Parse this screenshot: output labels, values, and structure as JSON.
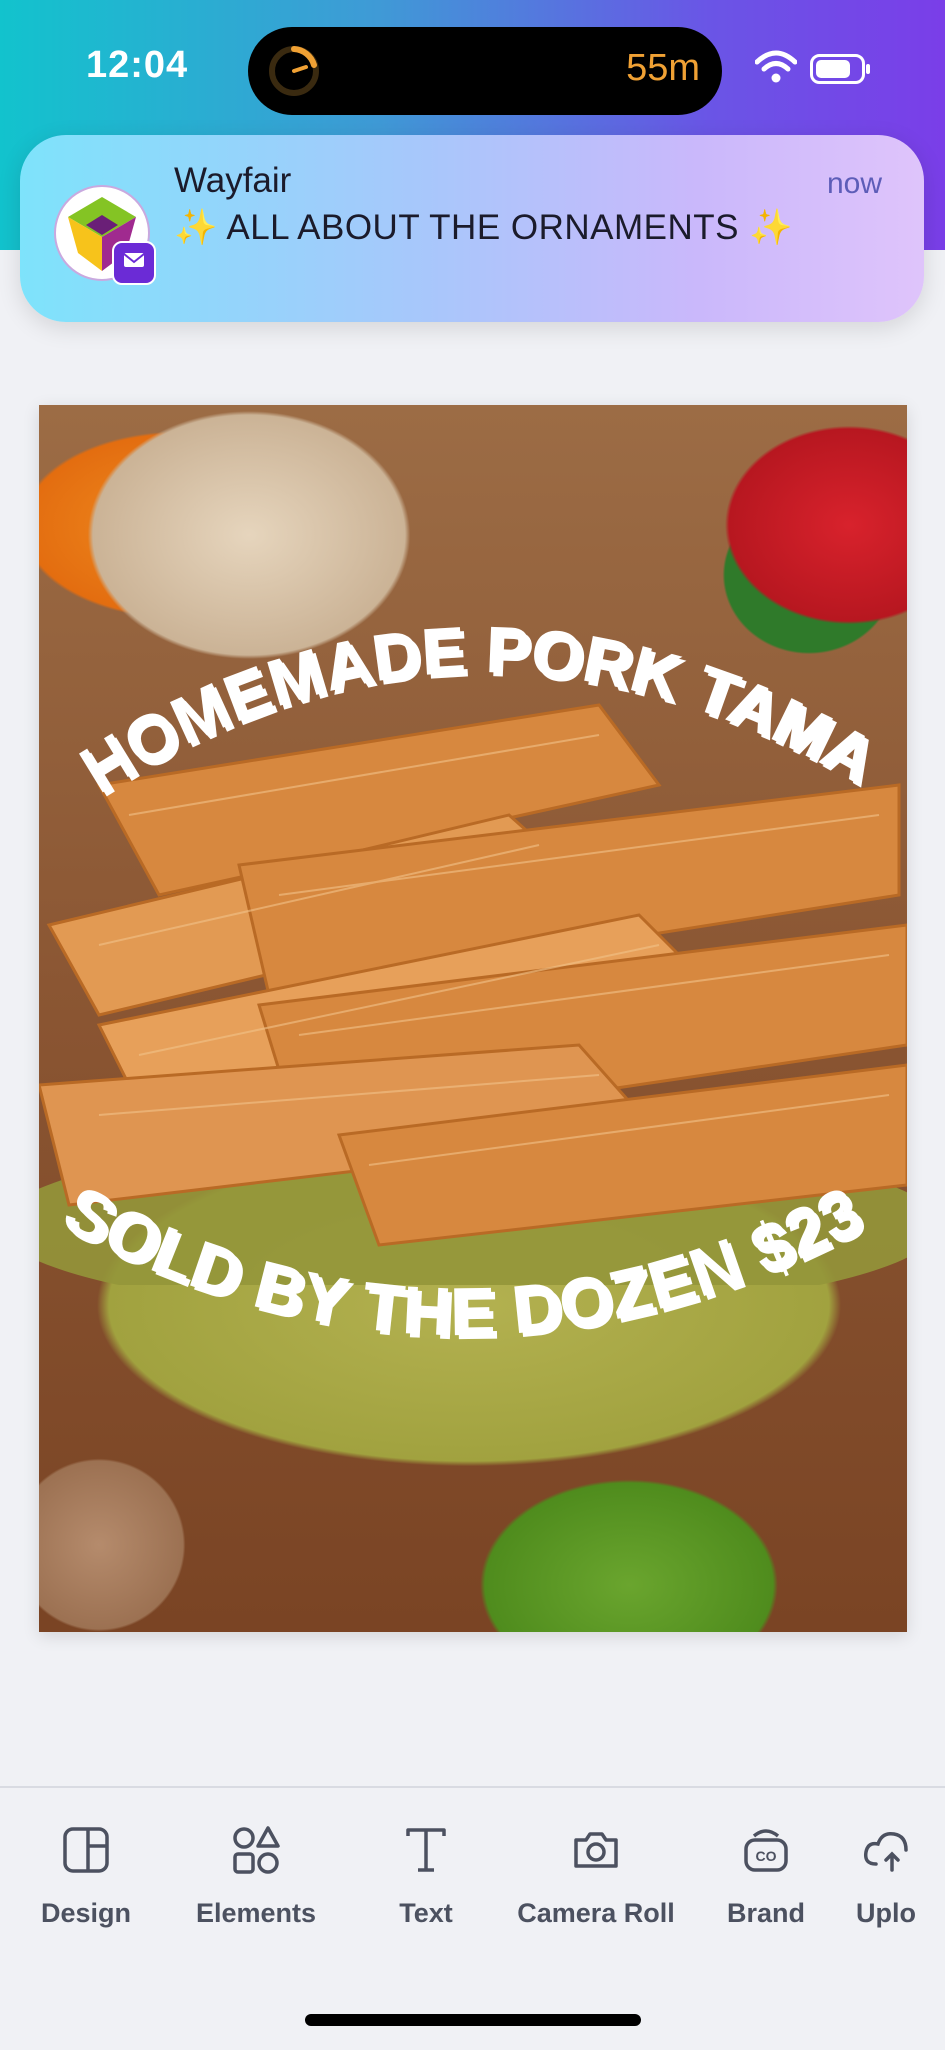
{
  "status_bar": {
    "time": "12:04",
    "island_timer_text": "55m",
    "icons": [
      "timer-icon",
      "wifi-icon",
      "battery-icon"
    ]
  },
  "notification": {
    "app_name": "Wayfair",
    "time": "now",
    "message": "✨ ALL ABOUT THE ORNAMENTS ✨",
    "icons": [
      "wayfair-app-icon",
      "yahoo-mail-badge-icon"
    ]
  },
  "design": {
    "headline": "HOMEMADE PORK  TAMALES",
    "subline": "SOLD BY THE DOZEN $23.00"
  },
  "toolbar": {
    "items": [
      {
        "label": "Design",
        "icon": "design-icon"
      },
      {
        "label": "Elements",
        "icon": "elements-icon"
      },
      {
        "label": "Text",
        "icon": "text-icon"
      },
      {
        "label": "Camera Roll",
        "icon": "camera-icon"
      },
      {
        "label": "Brand",
        "icon": "brand-icon"
      },
      {
        "label": "Uplo",
        "icon": "upload-icon"
      }
    ]
  },
  "colors": {
    "accent": "#7a3ee8",
    "timer": "#f0a134",
    "text": "#4c5160"
  }
}
